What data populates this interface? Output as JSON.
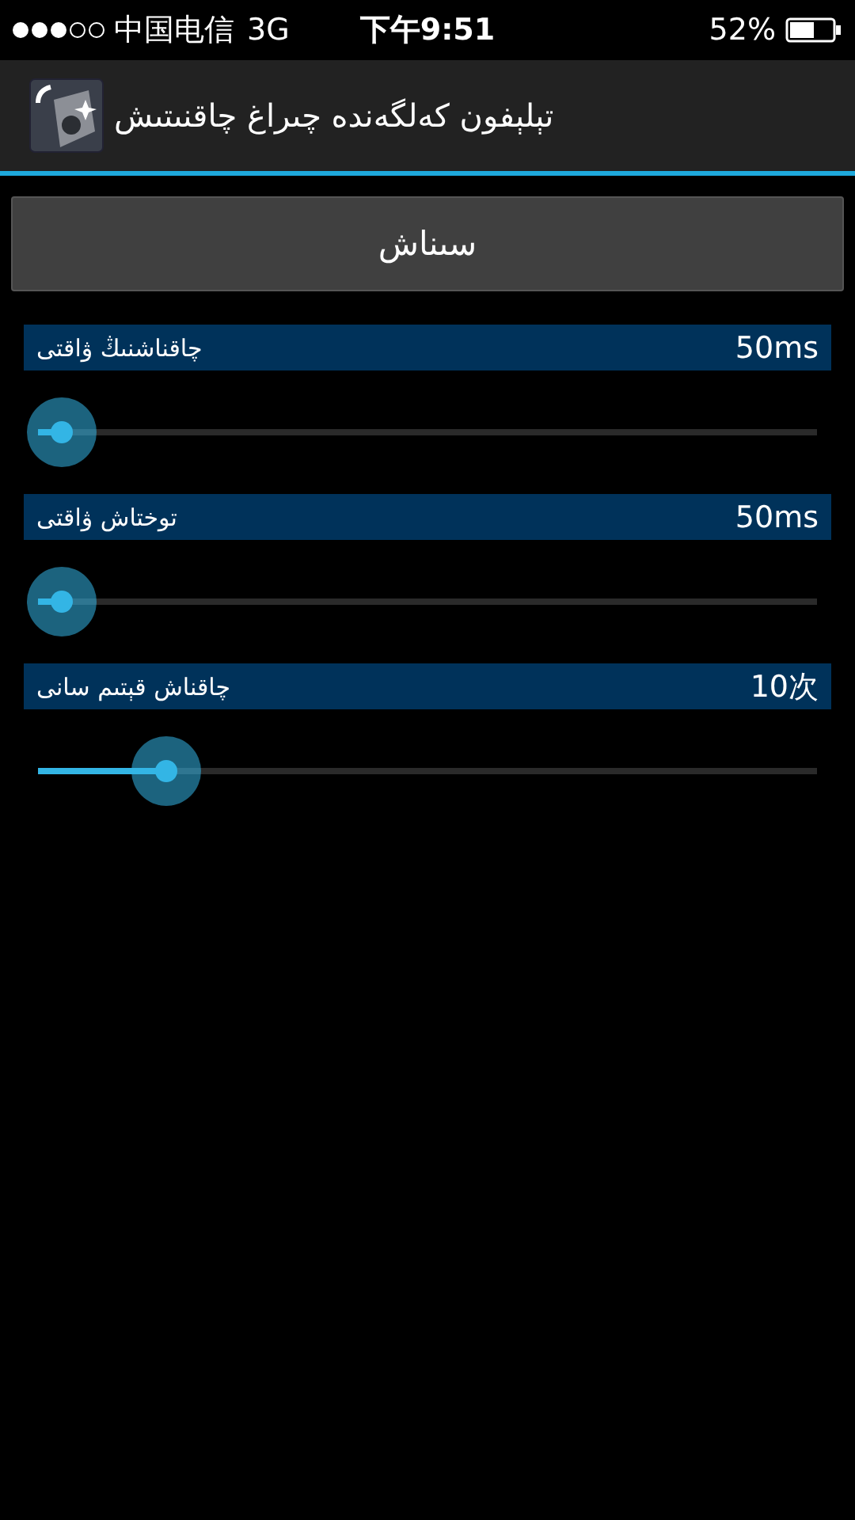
{
  "status_bar": {
    "signal_dots": [
      {
        "filled": true
      },
      {
        "filled": true
      },
      {
        "filled": true
      },
      {
        "filled": false
      },
      {
        "filled": false
      }
    ],
    "carrier": "中国电信",
    "network": "3G",
    "time": "下午9:51",
    "battery": "52%"
  },
  "action_bar": {
    "title": "تېلېفون كەلگەندە چىراغ چاقنىتىش"
  },
  "test_button": "سىناش",
  "settings": [
    {
      "label": "چاقناشنىڭ ۋاقتى",
      "value": "50ms",
      "level": 0.03
    },
    {
      "label": "توختاش ۋاقتى",
      "value": "50ms",
      "level": 0.03
    },
    {
      "label": "چاقناش قېتىم سانى",
      "value": "10次",
      "level": 0.165
    }
  ]
}
